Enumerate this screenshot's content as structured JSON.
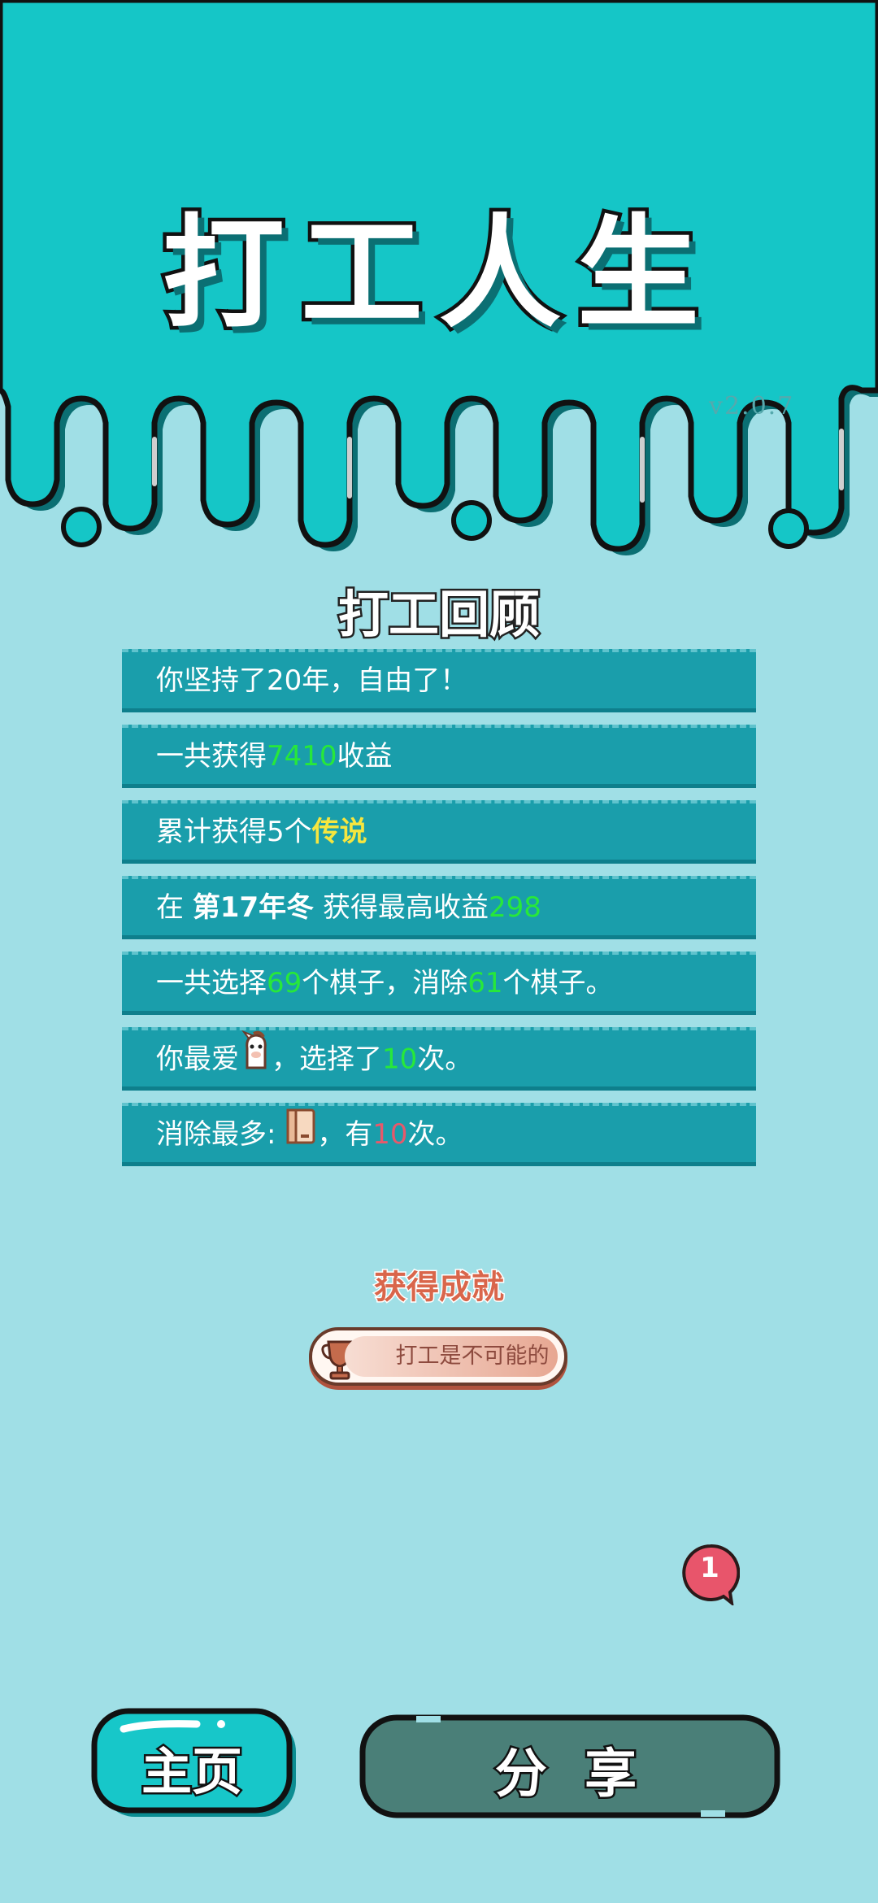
{
  "app": {
    "title": "打工人生",
    "version": "v2.0.7"
  },
  "review": {
    "title": "打工回顾",
    "rows": [
      {
        "parts": [
          {
            "t": "你坚持了20年，自由了！"
          }
        ]
      },
      {
        "parts": [
          {
            "t": "一共获得"
          },
          {
            "t": "7410",
            "c": "g"
          },
          {
            "t": "收益"
          }
        ]
      },
      {
        "parts": [
          {
            "t": "累计获得5个"
          },
          {
            "t": "传说",
            "c": "y"
          }
        ]
      },
      {
        "parts": [
          {
            "t": "在 "
          },
          {
            "t": "第17年冬",
            "c": "b"
          },
          {
            "t": " 获得最高收益"
          },
          {
            "t": "298",
            "c": "g"
          }
        ]
      },
      {
        "parts": [
          {
            "t": "一共选择"
          },
          {
            "t": "69",
            "c": "g"
          },
          {
            "t": "个棋子，消除"
          },
          {
            "t": "61",
            "c": "g"
          },
          {
            "t": "个棋子。"
          }
        ]
      },
      {
        "parts": [
          {
            "t": "你最爱"
          },
          {
            "icon": "cartoon-horse-icon"
          },
          {
            "t": "，选择了"
          },
          {
            "t": "10",
            "c": "g"
          },
          {
            "t": "次。"
          }
        ]
      },
      {
        "parts": [
          {
            "t": "消除最多: "
          },
          {
            "icon": "book-icon"
          },
          {
            "t": "，有"
          },
          {
            "t": "10",
            "c": "r"
          },
          {
            "t": "次。"
          }
        ]
      }
    ]
  },
  "achievement": {
    "title": "获得成就",
    "badge_label": "打工是不可能的",
    "icon": "trophy-icon"
  },
  "notification": {
    "count": "1"
  },
  "buttons": {
    "home": "主页",
    "share": "分 享"
  },
  "colors": {
    "header_teal": "#15c6c7",
    "background": "#a0dfe6",
    "row_teal": "#1a9eab",
    "highlight_green": "#27e83a",
    "highlight_yellow": "#f6e63f",
    "highlight_red": "#e7596b",
    "share_button": "#4a7f78",
    "badge_red": "#e8556b"
  }
}
